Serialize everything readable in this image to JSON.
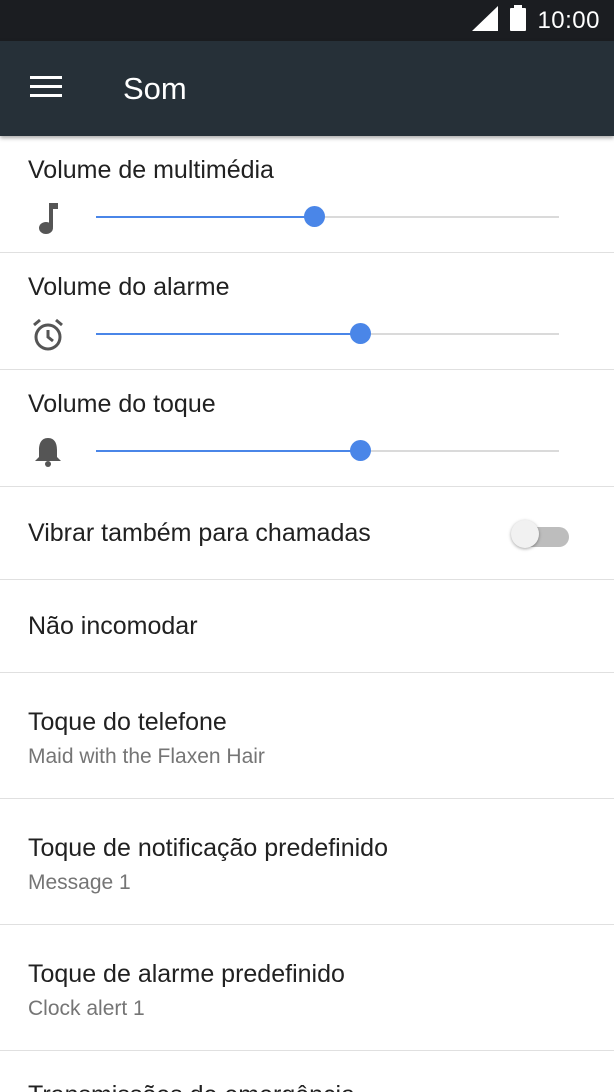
{
  "status_bar": {
    "time": "10:00",
    "icons": [
      "signal-icon",
      "battery-icon"
    ]
  },
  "app_bar": {
    "title": "Som",
    "menu_icon": "hamburger-menu-icon"
  },
  "colors": {
    "accent": "#4a86e8",
    "app_bar": "#263038",
    "status_bar": "#1b1d21"
  },
  "volumes": [
    {
      "label": "Volume de multimédia",
      "icon": "music-note-icon",
      "level": 0.47
    },
    {
      "label": "Volume do alarme",
      "icon": "alarm-clock-icon",
      "level": 0.57
    },
    {
      "label": "Volume do toque",
      "icon": "bell-icon",
      "level": 0.57
    }
  ],
  "vibrate": {
    "label": "Vibrar também para chamadas",
    "enabled": false
  },
  "do_not_disturb": {
    "label": "Não incomodar"
  },
  "ringtones": [
    {
      "title": "Toque do telefone",
      "value": "Maid with the Flaxen Hair"
    },
    {
      "title": "Toque de notificação predefinido",
      "value": "Message 1"
    },
    {
      "title": "Toque de alarme predefinido",
      "value": "Clock alert 1"
    }
  ],
  "emergency": {
    "title": "Transmissões de emergência"
  }
}
